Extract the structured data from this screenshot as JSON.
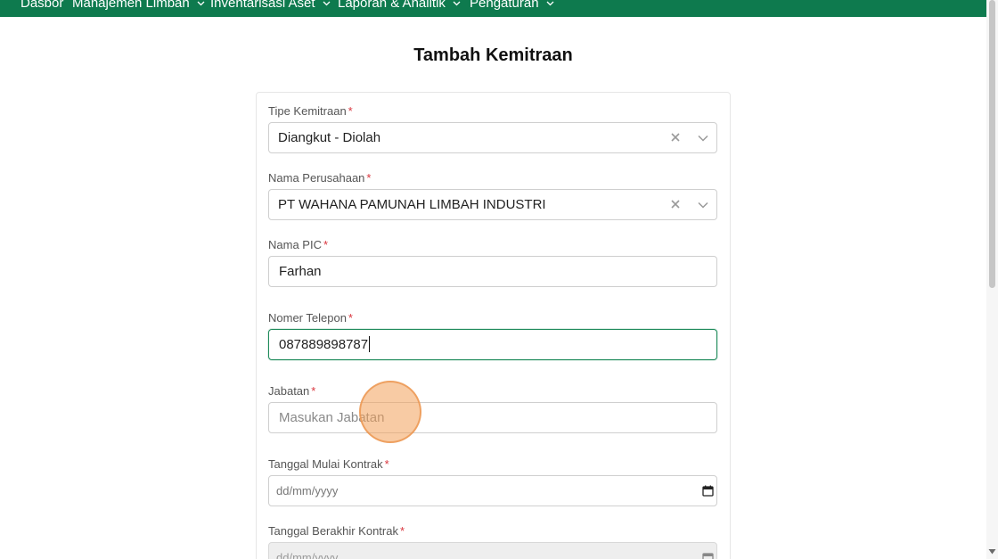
{
  "nav": {
    "items": [
      {
        "label": "Dasbor",
        "has_dropdown": false
      },
      {
        "label": "Manajemen Limbah",
        "has_dropdown": true
      },
      {
        "label": "Inventarisasi Aset",
        "has_dropdown": true
      },
      {
        "label": "Laporan & Analitik",
        "has_dropdown": true
      },
      {
        "label": "Pengaturan",
        "has_dropdown": true
      }
    ],
    "background_color": "#0e7a4e"
  },
  "page": {
    "title": "Tambah Kemitraan"
  },
  "form": {
    "required_marker": "*",
    "tipe_kemitraan": {
      "label": "Tipe Kemitraan",
      "value": "Diangkut - Diolah"
    },
    "nama_perusahaan": {
      "label": "Nama Perusahaan",
      "value": "PT WAHANA PAMUNAH LIMBAH INDUSTRI"
    },
    "nama_pic": {
      "label": "Nama PIC",
      "value": "Farhan"
    },
    "nomer_telepon": {
      "label": "Nomer Telepon",
      "value": "087889898787"
    },
    "jabatan": {
      "label": "Jabatan",
      "placeholder": "Masukan Jabatan"
    },
    "tanggal_mulai": {
      "label": "Tanggal Mulai Kontrak",
      "placeholder": "dd/mm/yyyy"
    },
    "tanggal_berakhir": {
      "label": "Tanggal Berakhir Kontrak",
      "placeholder": "dd/mm/yyyy"
    }
  },
  "colors": {
    "accent": "#0e7a4e",
    "focus_border": "#1e8a5a",
    "required": "#d9363e",
    "click_indicator": "#f3a05a"
  },
  "icons": {
    "clear": "close-icon",
    "dropdown": "chevron-down-icon",
    "calendar": "calendar-icon"
  }
}
